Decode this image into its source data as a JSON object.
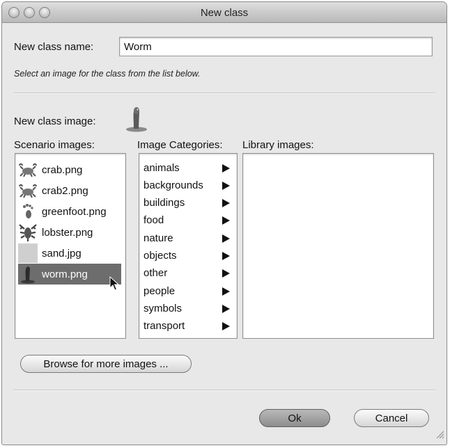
{
  "window": {
    "title": "New class"
  },
  "class_name": {
    "label": "New class name:",
    "value": "Worm"
  },
  "hint": "Select an image for the class from the list below.",
  "class_image": {
    "label": "New class image:",
    "icon": "worm-icon"
  },
  "scenario_images": {
    "label": "Scenario images:",
    "items": [
      {
        "name": "crab.png",
        "icon": "crab-icon"
      },
      {
        "name": "crab2.png",
        "icon": "crab-icon"
      },
      {
        "name": "greenfoot.png",
        "icon": "footprint-icon"
      },
      {
        "name": "lobster.png",
        "icon": "lobster-icon"
      },
      {
        "name": "sand.jpg",
        "icon": "sand-swatch"
      },
      {
        "name": "worm.png",
        "icon": "worm-icon",
        "selected": true
      }
    ]
  },
  "image_categories": {
    "label": "Image Categories:",
    "items": [
      "animals",
      "backgrounds",
      "buildings",
      "food",
      "nature",
      "objects",
      "other",
      "people",
      "symbols",
      "transport"
    ]
  },
  "library_images": {
    "label": "Library images:"
  },
  "buttons": {
    "browse": "Browse for more images ...",
    "ok": "Ok",
    "cancel": "Cancel"
  },
  "colors": {
    "selection": "#6d6d6d",
    "window_bg": "#e8e8e8"
  }
}
